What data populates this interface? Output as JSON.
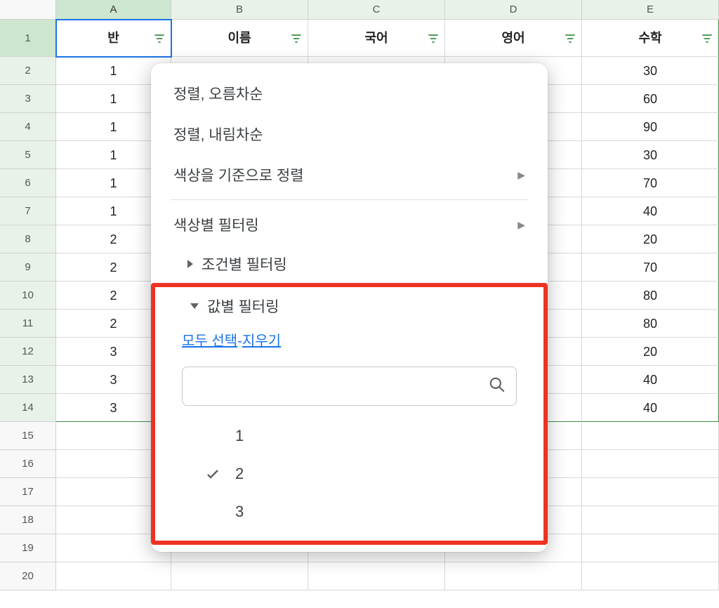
{
  "columns": [
    "A",
    "B",
    "C",
    "D",
    "E"
  ],
  "headers": {
    "A": "반",
    "B": "이름",
    "C": "국어",
    "D": "영어",
    "E": "수학"
  },
  "rows": [
    {
      "n": 1,
      "A": "반",
      "E": ""
    },
    {
      "n": 2,
      "A": "1",
      "E": "30"
    },
    {
      "n": 3,
      "A": "1",
      "E": "60"
    },
    {
      "n": 4,
      "A": "1",
      "E": "90"
    },
    {
      "n": 5,
      "A": "1",
      "E": "30"
    },
    {
      "n": 6,
      "A": "1",
      "E": "70"
    },
    {
      "n": 7,
      "A": "1",
      "E": "40"
    },
    {
      "n": 8,
      "A": "2",
      "E": "20"
    },
    {
      "n": 9,
      "A": "2",
      "E": "70"
    },
    {
      "n": 10,
      "A": "2",
      "E": "80"
    },
    {
      "n": 11,
      "A": "2",
      "E": "80"
    },
    {
      "n": 12,
      "A": "3",
      "E": "20"
    },
    {
      "n": 13,
      "A": "3",
      "E": "40"
    },
    {
      "n": 14,
      "A": "3",
      "E": "40"
    },
    {
      "n": 15,
      "A": "",
      "E": ""
    },
    {
      "n": 16,
      "A": "",
      "E": ""
    },
    {
      "n": 17,
      "A": "",
      "E": ""
    },
    {
      "n": 18,
      "A": "",
      "E": ""
    },
    {
      "n": 19,
      "A": "",
      "E": ""
    },
    {
      "n": 20,
      "A": "",
      "E": ""
    }
  ],
  "menu": {
    "sort_asc": "정렬, 오름차순",
    "sort_desc": "정렬, 내림차순",
    "sort_by_color": "색상을 기준으로 정렬",
    "filter_by_color": "색상별 필터링",
    "filter_by_condition": "조건별 필터링",
    "filter_by_values": "값별 필터링",
    "select_all": "모두 선택",
    "clear": "지우기",
    "search_placeholder": "",
    "values": [
      {
        "label": "1",
        "checked": false
      },
      {
        "label": "2",
        "checked": true
      },
      {
        "label": "3",
        "checked": false
      }
    ]
  },
  "colors": {
    "filter_icon": "#3a8f45"
  }
}
